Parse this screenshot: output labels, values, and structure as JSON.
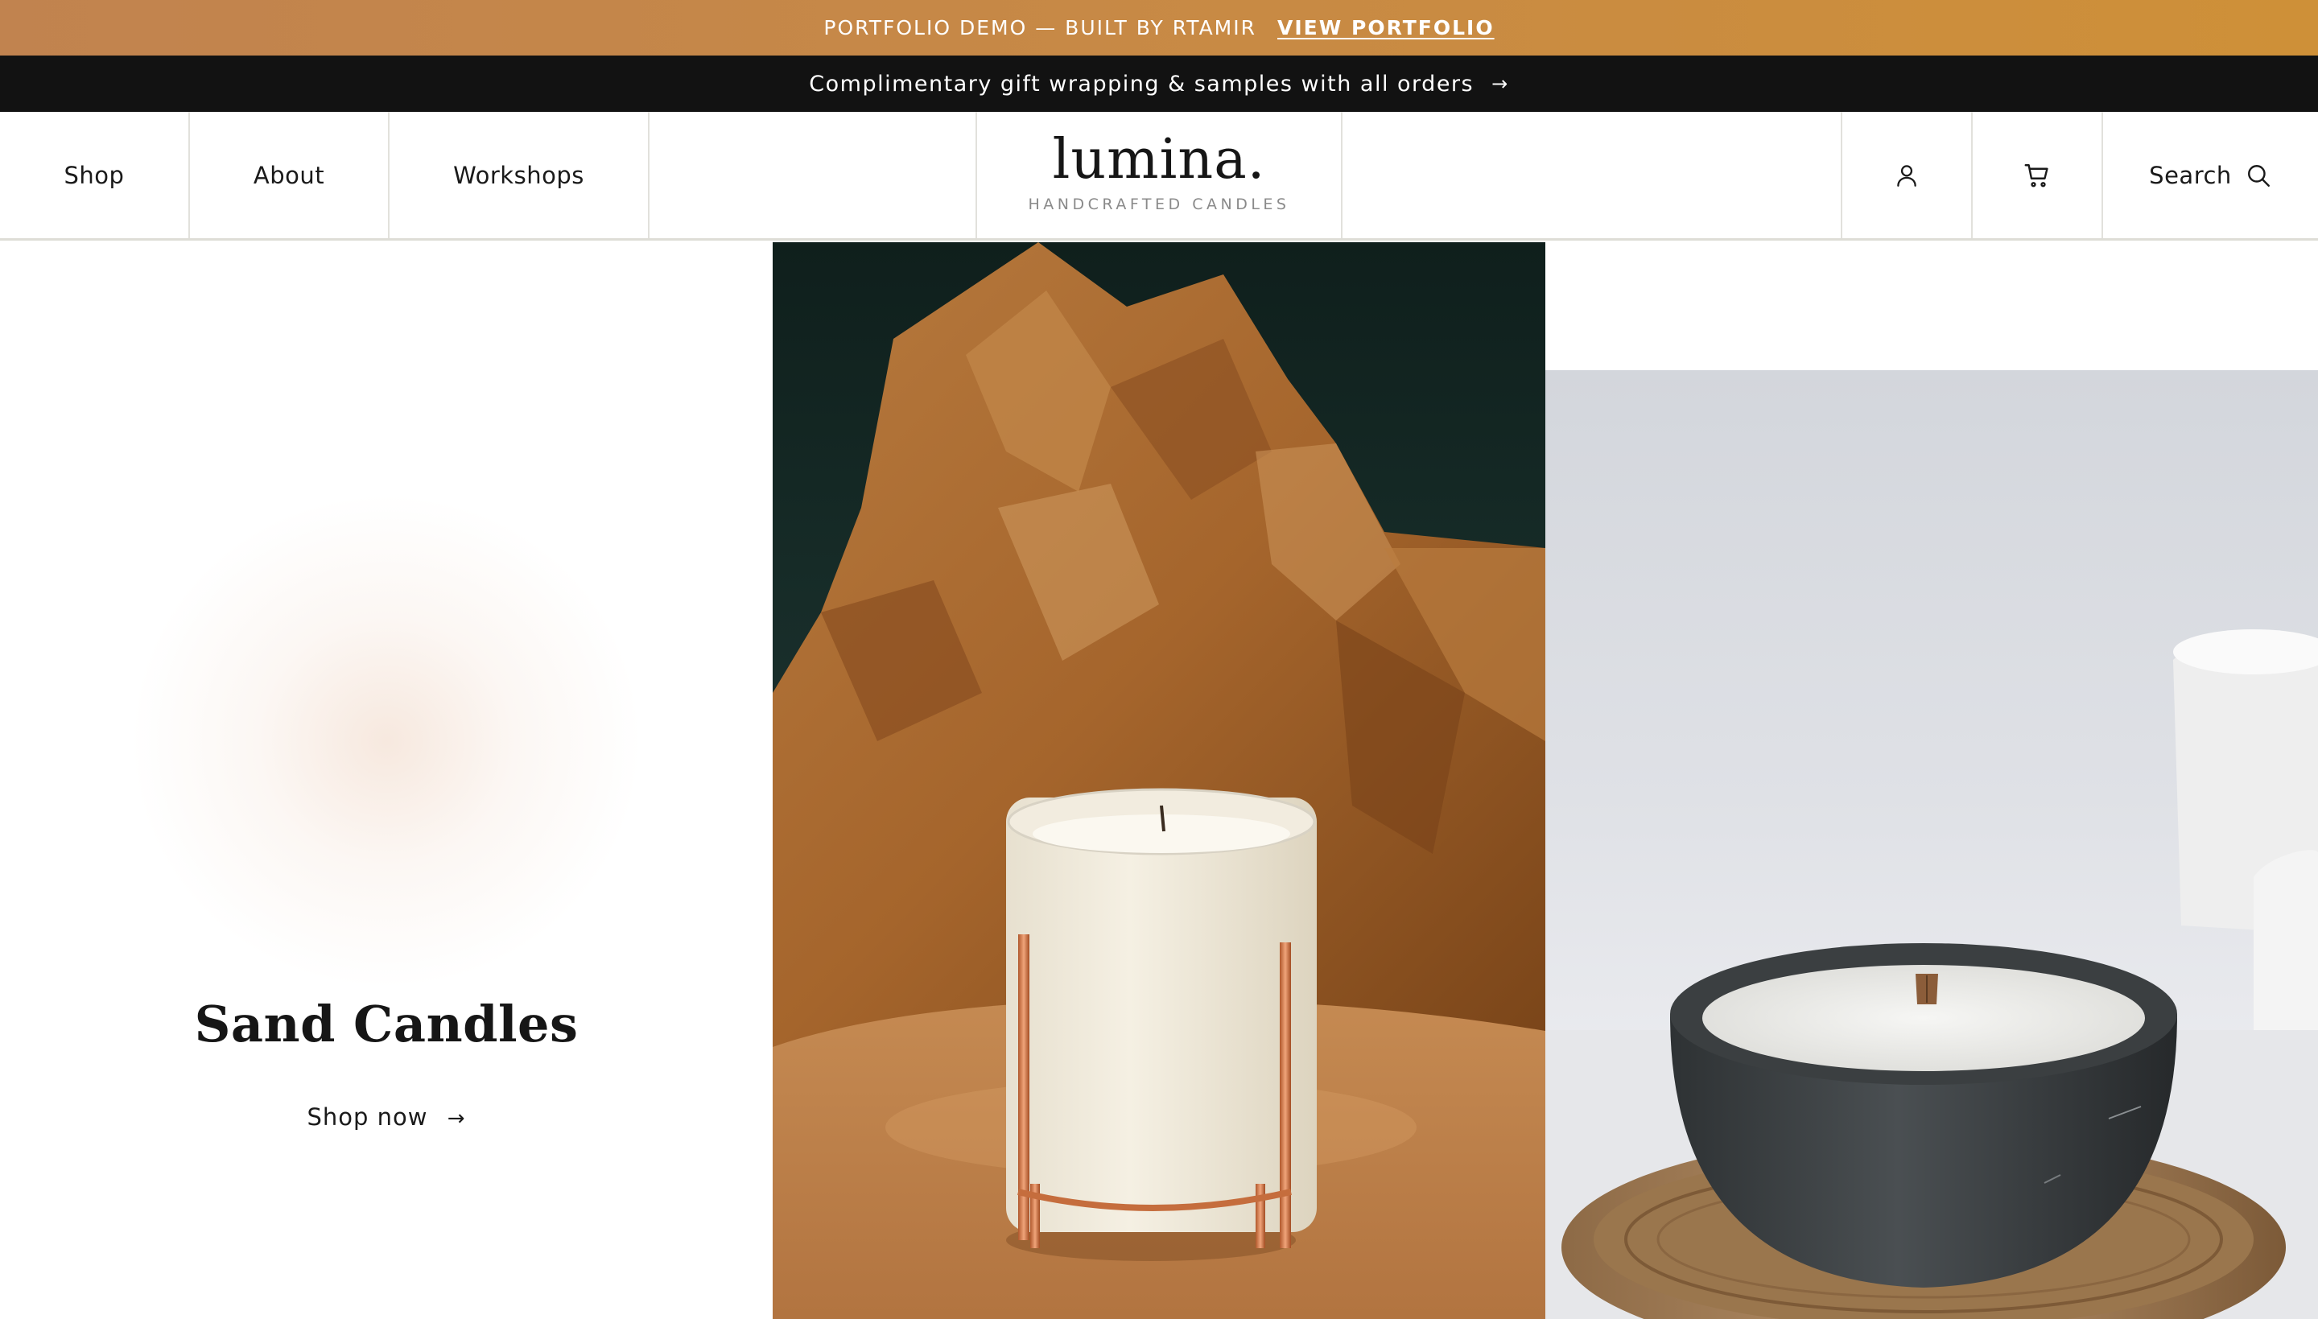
{
  "portfolio_bar": {
    "text": "PORTFOLIO DEMO — BUILT BY RTAMIR",
    "link_label": "VIEW PORTFOLIO"
  },
  "announcement": {
    "text": "Complimentary gift wrapping & samples with all orders",
    "arrow": "→"
  },
  "nav": {
    "items": [
      {
        "label": "Shop"
      },
      {
        "label": "About"
      },
      {
        "label": "Workshops"
      }
    ]
  },
  "brand": {
    "name": "lumina.",
    "tagline": "HANDCRAFTED CANDLES"
  },
  "header_actions": {
    "account_icon": "user-icon",
    "cart_icon": "cart-icon",
    "search_label": "Search",
    "search_icon": "search-icon"
  },
  "hero": {
    "title": "Sand Candles",
    "cta_label": "Shop now",
    "cta_arrow": "→"
  },
  "images": [
    {
      "subject": "candle-in-glass-with-copper-stand-kraft-paper"
    },
    {
      "subject": "candle-in-concrete-bowl-on-wooden-tray"
    }
  ],
  "colors": {
    "portfolio_bar": "#c88a44",
    "announcement_bar": "#121212",
    "header_border": "#deddd6"
  }
}
